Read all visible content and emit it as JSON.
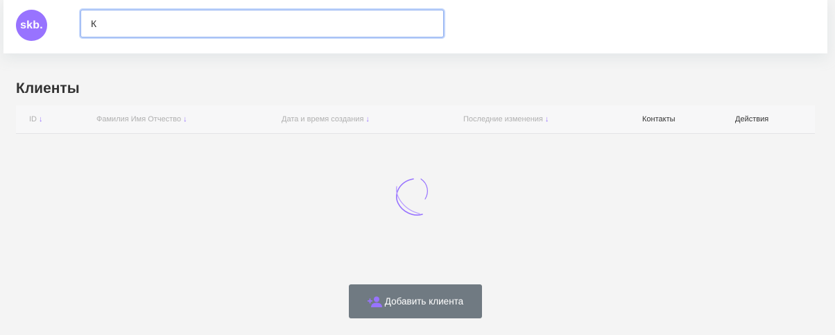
{
  "header": {
    "logo_text": "skb.",
    "search_value": "К",
    "search_placeholder": ""
  },
  "page": {
    "title": "Клиенты"
  },
  "table": {
    "columns": [
      {
        "label": "ID",
        "sortable": true
      },
      {
        "label": "Фамилия Имя Отчество",
        "sortable": true
      },
      {
        "label": "Дата и время создания",
        "sortable": true
      },
      {
        "label": "Последние изменения",
        "sortable": true
      },
      {
        "label": "Контакты",
        "sortable": false
      },
      {
        "label": "Действия",
        "sortable": false
      }
    ],
    "sort_arrow": "↓",
    "rows": []
  },
  "loading": true,
  "actions": {
    "add_client_label": "Добавить клиента",
    "add_client_icon": "add-user-icon"
  },
  "colors": {
    "accent": "#9873ff",
    "button_bg": "#707a82",
    "page_bg": "#f4f4f4"
  }
}
